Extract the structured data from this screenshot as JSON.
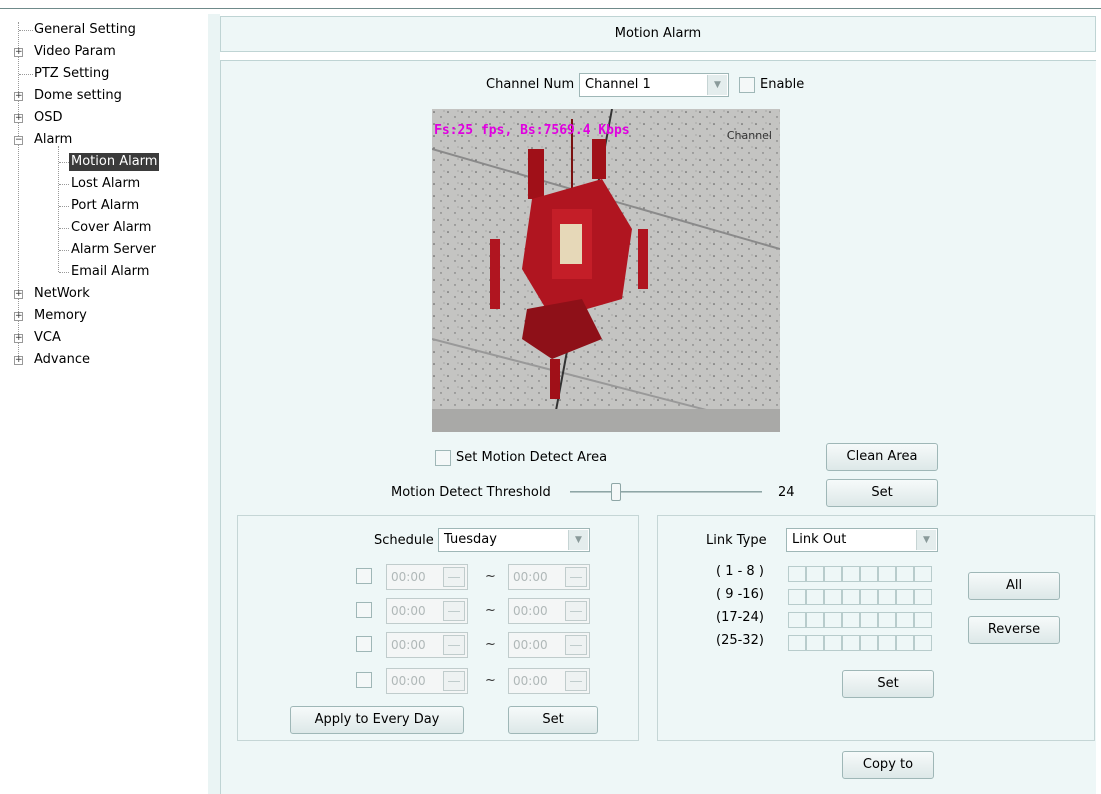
{
  "tree": {
    "items": [
      {
        "label": "General Setting"
      },
      {
        "label": "Video Param"
      },
      {
        "label": "PTZ Setting"
      },
      {
        "label": "Dome setting"
      },
      {
        "label": "OSD"
      },
      {
        "label": "Alarm"
      },
      {
        "label": "Motion Alarm"
      },
      {
        "label": "Lost Alarm"
      },
      {
        "label": "Port Alarm"
      },
      {
        "label": "Cover Alarm"
      },
      {
        "label": "Alarm Server"
      },
      {
        "label": "Email Alarm"
      },
      {
        "label": "NetWork"
      },
      {
        "label": "Memory"
      },
      {
        "label": "VCA"
      },
      {
        "label": "Advance"
      }
    ]
  },
  "header": {
    "title": "Motion Alarm"
  },
  "channel": {
    "label": "Channel Num",
    "value": "Channel 1",
    "enable_label": "Enable"
  },
  "video": {
    "overlay": "Fs:25 fps, Bs:7569.4 Kbps",
    "channel_tag": "Channel"
  },
  "area": {
    "set_label": "Set Motion Detect Area",
    "clean_button": "Clean Area"
  },
  "threshold": {
    "label": "Motion Detect Threshold",
    "value": "24",
    "set_button": "Set"
  },
  "schedule": {
    "label": "Schedule",
    "day": "Tuesday",
    "rows": [
      {
        "start": "00:00",
        "end": "00:00"
      },
      {
        "start": "00:00",
        "end": "00:00"
      },
      {
        "start": "00:00",
        "end": "00:00"
      },
      {
        "start": "00:00",
        "end": "00:00"
      }
    ],
    "tilde": "~",
    "apply_button": "Apply to Every Day",
    "set_button": "Set"
  },
  "link": {
    "label": "Link Type",
    "value": "Link Out",
    "ranges": [
      "( 1 - 8 )",
      "( 9 -16)",
      "(17-24)",
      "(25-32)"
    ],
    "all_button": "All",
    "reverse_button": "Reverse",
    "set_button": "Set"
  },
  "copy_button": "Copy to",
  "colors": {
    "panel": "#eef7f7",
    "border": "#9fb7b7",
    "overlay_text": "#e000e0",
    "selected": "#3b3b3b"
  }
}
